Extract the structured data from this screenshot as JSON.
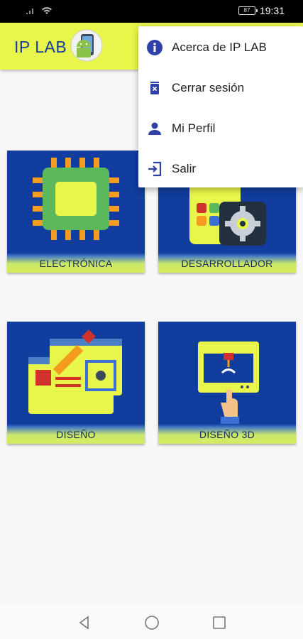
{
  "status_bar": {
    "battery": "87",
    "time": "19:31"
  },
  "app_bar": {
    "title": "IP LAB"
  },
  "categories": [
    {
      "label": "ELECTRÓNICA"
    },
    {
      "label": "DESARROLLADOR"
    },
    {
      "label": "DISEÑO"
    },
    {
      "label": "DISEÑO 3D"
    }
  ],
  "menu": {
    "items": [
      {
        "label": "Acerca de IP LAB",
        "icon": "info-icon"
      },
      {
        "label": "Cerrar sesión",
        "icon": "delete-icon"
      },
      {
        "label": "Mi Perfil",
        "icon": "person-icon"
      },
      {
        "label": "Salir",
        "icon": "exit-icon"
      }
    ]
  },
  "colors": {
    "accent": "#e8f54a",
    "card": "#103d9e",
    "menu_icon": "#2f41a8"
  }
}
